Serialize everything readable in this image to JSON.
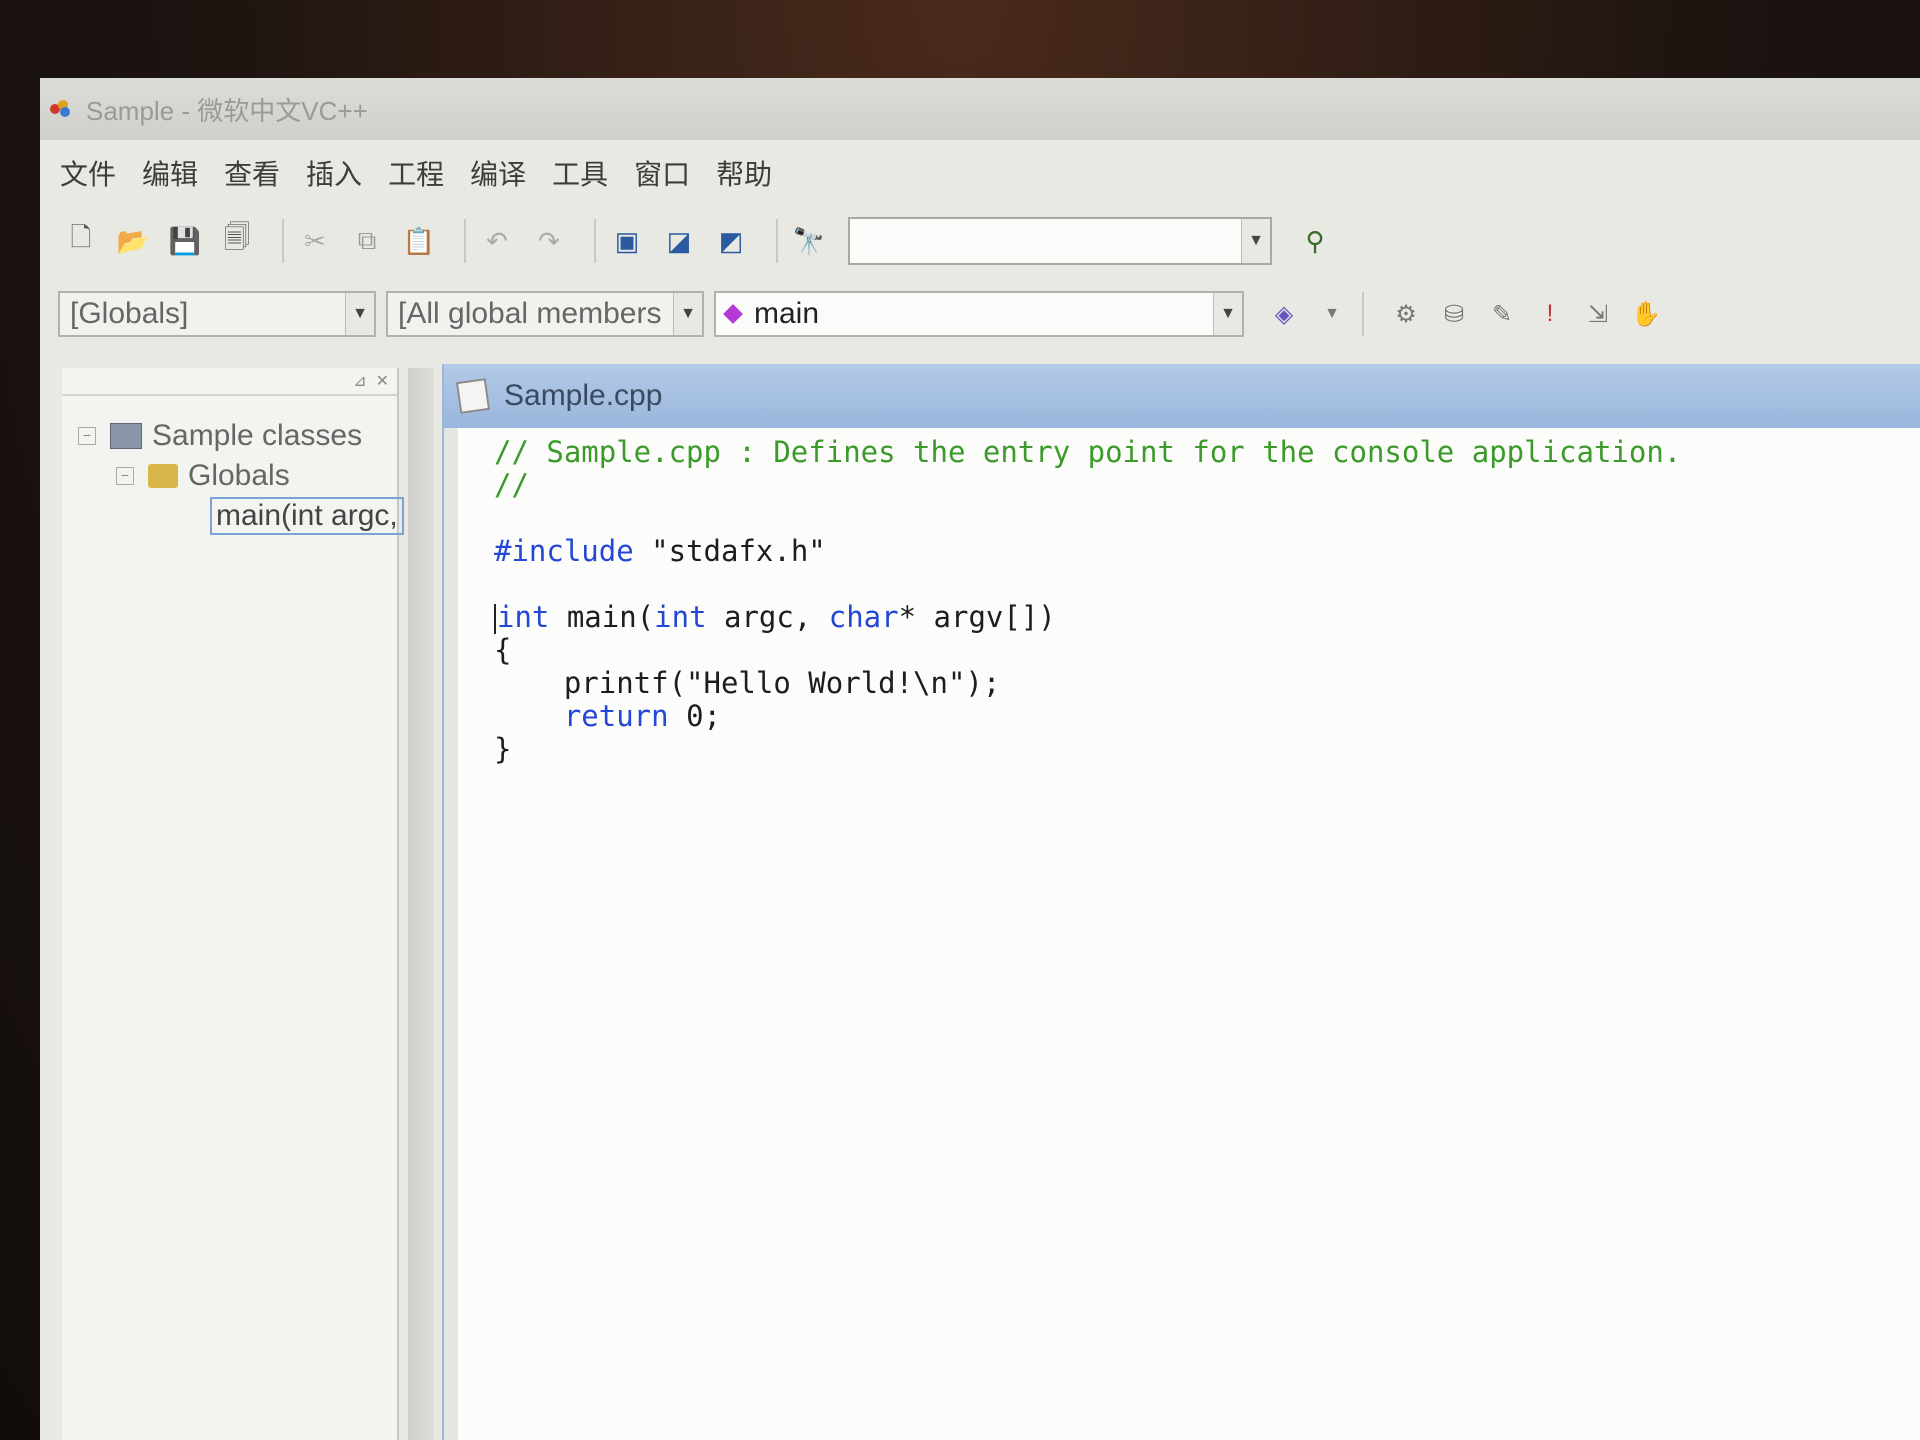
{
  "window": {
    "title": "Sample - 微软中文VC++"
  },
  "menu": [
    "文件",
    "编辑",
    "查看",
    "插入",
    "工程",
    "编译",
    "工具",
    "窗口",
    "帮助"
  ],
  "toolbar": {
    "find_value": ""
  },
  "wizard_bar": {
    "class_combo": "[Globals]",
    "filter_combo": "[All global members",
    "member_combo": "main"
  },
  "workspace": {
    "root": "Sample classes",
    "folder": "Globals",
    "function": "main(int argc,"
  },
  "editor": {
    "tab_title": "Sample.cpp",
    "lines": [
      {
        "cls": "cm",
        "text": "// Sample.cpp : Defines the entry point for the console application."
      },
      {
        "cls": "cm",
        "text": "//"
      },
      {
        "cls": "",
        "text": ""
      },
      {
        "cls": "inc",
        "kw": "#include",
        "rest": " \"stdafx.h\""
      },
      {
        "cls": "",
        "text": ""
      },
      {
        "cls": "sig",
        "kw1": "int",
        "t1": " main(",
        "kw2": "int",
        "t2": " argc, ",
        "kw3": "char",
        "t3": "* argv[])"
      },
      {
        "cls": "",
        "text": "{"
      },
      {
        "cls": "",
        "text": "    printf(\"Hello World!\\n\");"
      },
      {
        "cls": "ret",
        "kw": "return",
        "rest": " 0;"
      },
      {
        "cls": "",
        "text": "}"
      }
    ]
  }
}
